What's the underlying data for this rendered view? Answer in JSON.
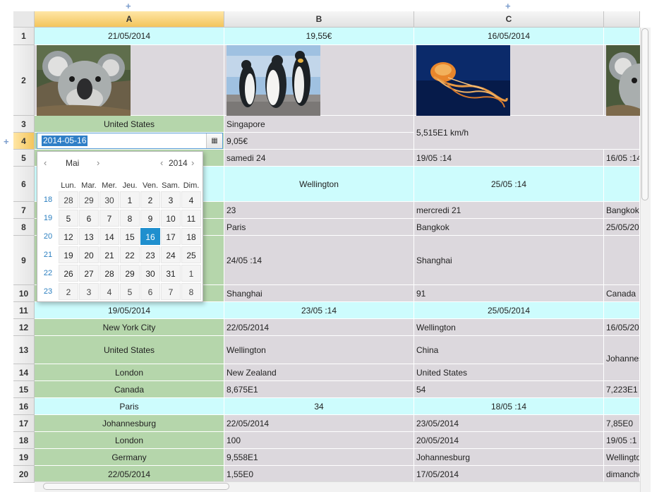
{
  "columns": [
    "A",
    "B",
    "C"
  ],
  "rows": [
    "1",
    "2",
    "3",
    "4",
    "5",
    "6",
    "7",
    "8",
    "9",
    "10",
    "11",
    "12",
    "13",
    "14",
    "15",
    "16",
    "17",
    "18",
    "19",
    "20"
  ],
  "cells": {
    "r1": {
      "a": "21/05/2014",
      "b": "19,55€",
      "c": "16/05/2014"
    },
    "r3": {
      "a": "United States",
      "b": "Singapore"
    },
    "r34": {
      "c": "5,515E1 km/h"
    },
    "r4": {
      "b": "9,05€"
    },
    "r5": {
      "b": "samedi 24",
      "c": "19/05 :14",
      "d": "16/05 :14"
    },
    "r6": {
      "b": "Wellington",
      "c": "25/05 :14"
    },
    "r7": {
      "b": "23",
      "c": "mercredi 21",
      "d": "Bangkok"
    },
    "r8": {
      "b": "Paris",
      "c": "Bangkok",
      "d": "25/05/20"
    },
    "r9": {
      "b": "24/05 :14",
      "c": "Shanghai"
    },
    "r10": {
      "b": "Shanghai",
      "c": "91",
      "d": "Canada"
    },
    "r11": {
      "a": "19/05/2014",
      "b": "23/05 :14",
      "c": "25/05/2014"
    },
    "r12": {
      "a": "New York City",
      "b": "22/05/2014",
      "c": "Wellington",
      "d": "16/05/20"
    },
    "r13": {
      "a": "United States",
      "b": "Wellington",
      "c": "China"
    },
    "r1314": {
      "d": "Johannes"
    },
    "r14": {
      "a": "London",
      "b": "New Zealand",
      "c": "United States"
    },
    "r15": {
      "a": "Canada",
      "b": "8,675E1",
      "c": "54",
      "d": "7,223E1"
    },
    "r16": {
      "a": "Paris",
      "b": "34",
      "c": "18/05 :14"
    },
    "r17": {
      "a": "Johannesburg",
      "b": "22/05/2014",
      "c": "23/05/2014",
      "d": "7,85E0"
    },
    "r18": {
      "a": "London",
      "b": "100",
      "c": "20/05/2014",
      "d": "19/05 :1"
    },
    "r19": {
      "a": "Germany",
      "b": "9,558E1",
      "c": "Johannesburg",
      "d": "Wellingto"
    },
    "r20": {
      "a": "22/05/2014",
      "b": "1,55E0",
      "c": "17/05/2014",
      "d": "dimanche"
    }
  },
  "images": {
    "a2": "koala",
    "b2": "penguins",
    "c2": "jellyfish",
    "d2": "koala"
  },
  "editor": {
    "value": "2014-05-16",
    "button_icon": "calendar-icon"
  },
  "datepicker": {
    "month": "Mai",
    "year": "2014",
    "weekdays": [
      "Lun.",
      "Mar.",
      "Mer.",
      "Jeu.",
      "Ven.",
      "Sam.",
      "Dim."
    ],
    "weeks": [
      {
        "num": "18",
        "days": [
          "28",
          "29",
          "30",
          "1",
          "2",
          "3",
          "4"
        ]
      },
      {
        "num": "19",
        "days": [
          "5",
          "6",
          "7",
          "8",
          "9",
          "10",
          "11"
        ]
      },
      {
        "num": "20",
        "days": [
          "12",
          "13",
          "14",
          "15",
          "16",
          "17",
          "18"
        ]
      },
      {
        "num": "21",
        "days": [
          "19",
          "20",
          "21",
          "22",
          "23",
          "24",
          "25"
        ]
      },
      {
        "num": "22",
        "days": [
          "26",
          "27",
          "28",
          "29",
          "30",
          "31",
          "1"
        ]
      },
      {
        "num": "23",
        "days": [
          "2",
          "3",
          "4",
          "5",
          "6",
          "7",
          "8"
        ]
      }
    ],
    "selected_day": "16"
  }
}
